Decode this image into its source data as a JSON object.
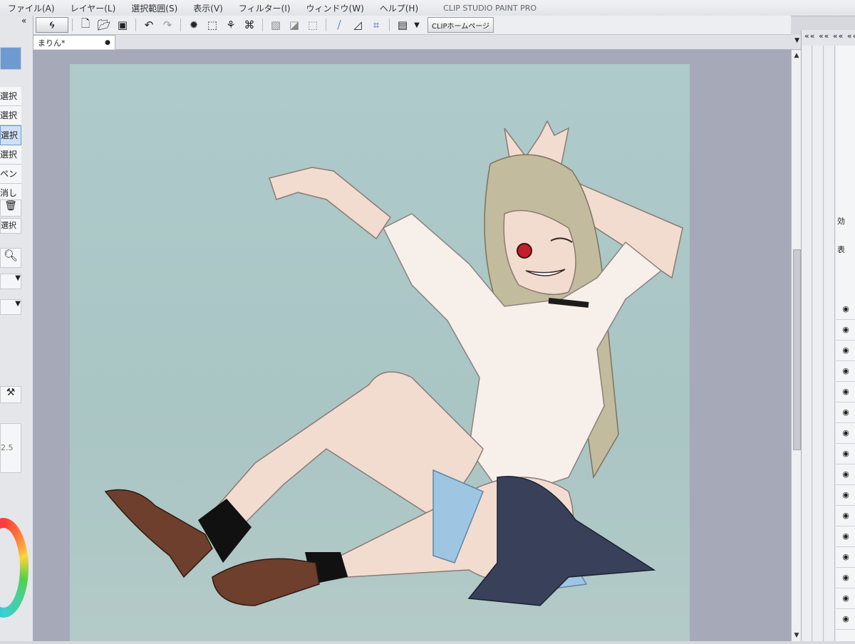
{
  "menubar": {
    "items": [
      "ファイル(A)",
      "レイヤー(L)",
      "選択範囲(S)",
      "表示(V)",
      "フィルター(I)",
      "ウィンドウ(W)",
      "ヘルプ(H)"
    ],
    "app_title": "CLIP STUDIO PAINT PRO"
  },
  "toolbar": {
    "homepage_button": "CLIPホームページ"
  },
  "document_tab": {
    "name": "まりん*",
    "close_glyph": "●"
  },
  "left_panel": {
    "tools": [
      "選択",
      "選択",
      "選択",
      "選択",
      "ペン",
      "消し"
    ],
    "active_tool_index": 2,
    "sub_tool_label": "選択",
    "value_label": "2.5",
    "collapse_glyph": "«"
  },
  "right_panel": {
    "collapse_glyph": "«« «« «« ««",
    "texts": [
      "効",
      "表"
    ]
  },
  "colors": {
    "canvas_bg": "#aecaca",
    "workspace": "#a6a9b8",
    "accent": "#6f9ad0"
  }
}
